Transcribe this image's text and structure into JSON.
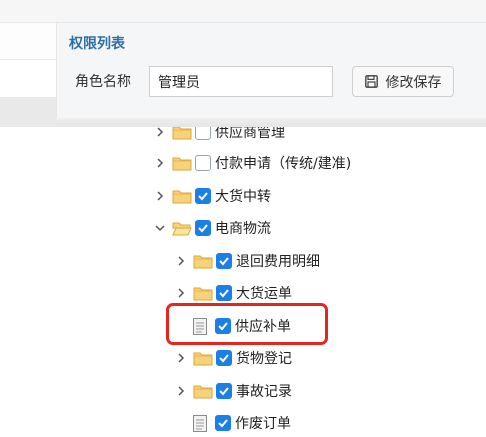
{
  "panel": {
    "title": "权限列表",
    "role_label": "角色名称",
    "role_value": "管理员",
    "save_label": "修改保存"
  },
  "tree": {
    "nodes": [
      {
        "label": "供应商管理",
        "checked": false,
        "type": "folder",
        "expanded": false
      },
      {
        "label": "付款申请（传统/建准)",
        "checked": false,
        "type": "folder",
        "expanded": false
      },
      {
        "label": "大货中转",
        "checked": true,
        "type": "folder",
        "expanded": false
      },
      {
        "label": "电商物流",
        "checked": true,
        "type": "folder",
        "expanded": true
      },
      {
        "label": "退回费用明细",
        "checked": true,
        "type": "folder",
        "expanded": false
      },
      {
        "label": "大货运单",
        "checked": true,
        "type": "folder",
        "expanded": false
      },
      {
        "label": "供应补单",
        "checked": true,
        "type": "doc",
        "expanded": false,
        "highlighted": true
      },
      {
        "label": "货物登记",
        "checked": true,
        "type": "folder",
        "expanded": false
      },
      {
        "label": "事故记录",
        "checked": true,
        "type": "folder",
        "expanded": false
      },
      {
        "label": "作废订单",
        "checked": true,
        "type": "doc",
        "expanded": false
      }
    ]
  },
  "colors": {
    "accent": "#1a7fe6",
    "title": "#2f6fa8",
    "highlight": "#e3261f",
    "folder": "#f5c451"
  }
}
